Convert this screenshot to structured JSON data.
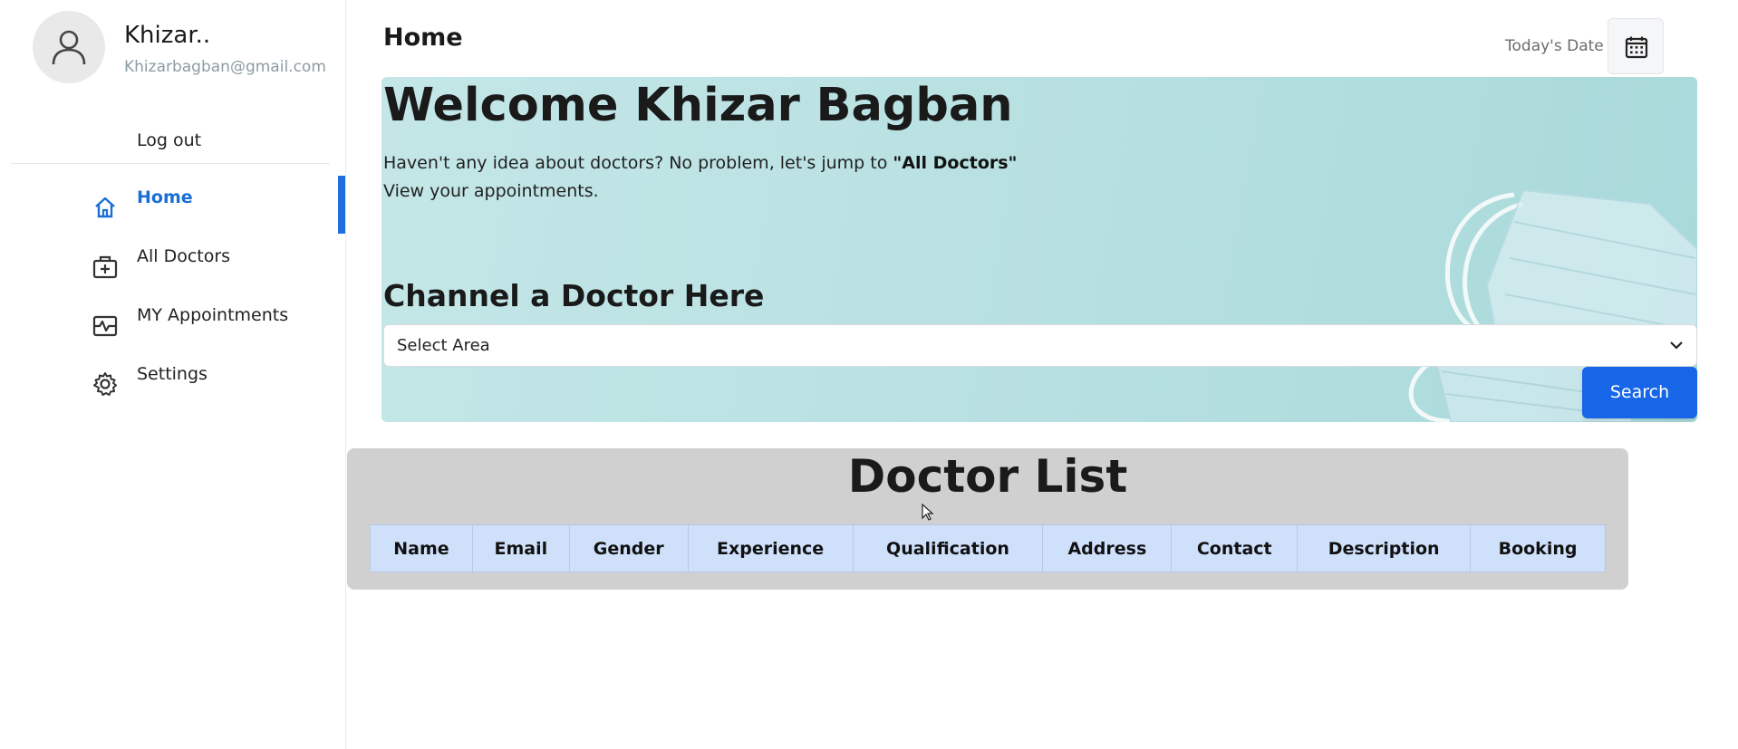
{
  "profile": {
    "name": "Khizar..",
    "email": "Khizarbagban@gmail.com"
  },
  "sidebar": {
    "logout_label": "Log out",
    "items": [
      {
        "label": "Home",
        "icon": "home-icon",
        "active": true
      },
      {
        "label": "All Doctors",
        "icon": "medical-bag-icon",
        "active": false
      },
      {
        "label": "MY Appointments",
        "icon": "appointments-icon",
        "active": false
      },
      {
        "label": "Settings",
        "icon": "gear-icon",
        "active": false
      }
    ]
  },
  "header": {
    "title": "Home",
    "date_label": "Today's Date",
    "calendar_icon": "calendar-icon"
  },
  "hero": {
    "welcome": "Welcome Khizar Bagban",
    "text_before_bold": "Haven't any idea about doctors? No problem, let's jump to ",
    "text_bold": "\"All Doctors\"",
    "text2": "View your appointments.",
    "channel_title": "Channel a Doctor Here",
    "select_value": "Select Area",
    "search_label": "Search"
  },
  "doctor_list": {
    "title": "Doctor List",
    "columns": [
      "Name",
      "Email",
      "Gender",
      "Experience",
      "Qualification",
      "Address",
      "Contact",
      "Description",
      "Booking"
    ]
  },
  "colors": {
    "accent": "#1766e8",
    "active_text": "#1a6fd6",
    "table_header": "#cfe0fb",
    "card_bg": "#d0d0d0"
  }
}
